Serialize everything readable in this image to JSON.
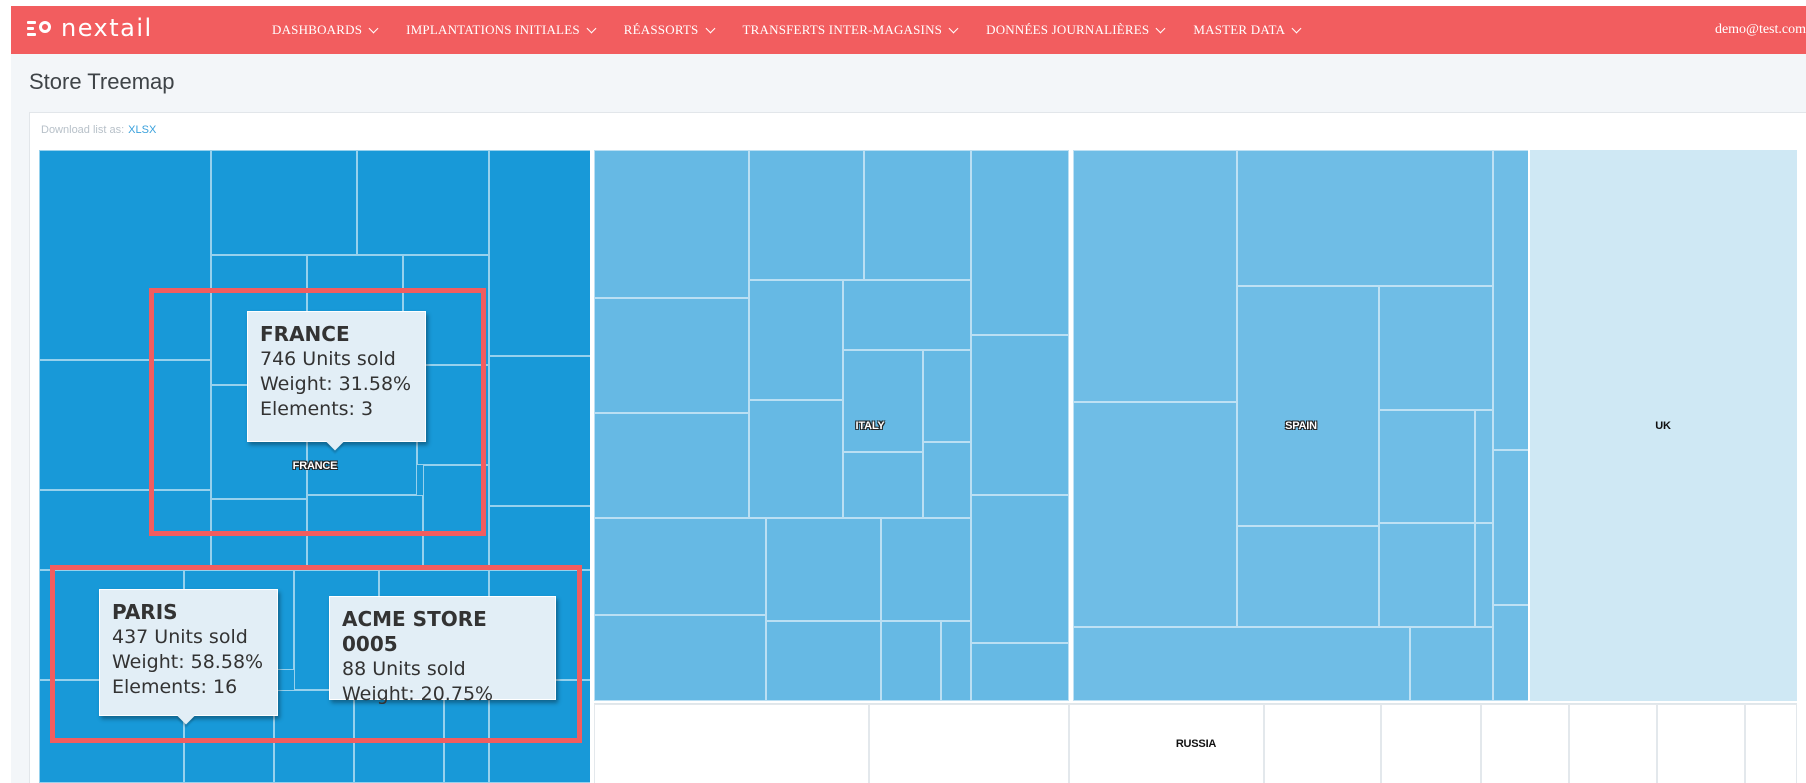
{
  "app": {
    "brand": "nextail",
    "user": "demo@test.com"
  },
  "nav": {
    "items": [
      {
        "label": "DASHBOARDS"
      },
      {
        "label": "IMPLANTATIONS INITIALES"
      },
      {
        "label": "RÉASSORTS"
      },
      {
        "label": "TRANSFERTS INTER-MAGASINS"
      },
      {
        "label": "DONNÉES JOURNALIÈRES"
      },
      {
        "label": "MASTER DATA"
      }
    ]
  },
  "page": {
    "title": "Store Treemap",
    "download_label": "Download list as:",
    "download_link": "XLSX"
  },
  "treemap": {
    "regions": [
      {
        "name": "FRANCE",
        "color": "#1899d8"
      },
      {
        "name": "ITALY",
        "color": "#66b9e4"
      },
      {
        "name": "SPAIN",
        "color": "#6fbde6"
      },
      {
        "name": "UK",
        "color": "#cfe8f4"
      },
      {
        "name": "RUSSIA",
        "color": "#ffffff"
      }
    ]
  },
  "tooltips": {
    "france": {
      "title": "FRANCE",
      "units": "746 Units sold",
      "weight": "Weight: 31.58%",
      "elements": "Elements: 3"
    },
    "paris": {
      "title": "PARIS",
      "units": "437 Units sold",
      "weight": "Weight: 58.58%",
      "elements": "Elements: 16"
    },
    "store": {
      "title": "ACME STORE 0005",
      "units": "88 Units sold",
      "weight": "Weight: 20.75%"
    }
  }
}
